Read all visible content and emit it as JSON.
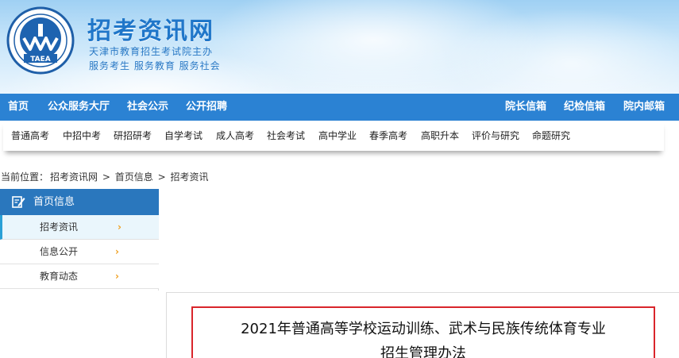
{
  "header": {
    "logo_text": "TAEA",
    "site_title": "招考资讯网",
    "org": "天津市教育招生考试院主办",
    "slogan": "服务考生 服务教育 服务社会"
  },
  "main_nav": {
    "left": [
      "首页",
      "公众服务大厅",
      "社会公示",
      "公开招聘"
    ],
    "right": [
      "院长信箱",
      "纪检信箱",
      "院内邮箱"
    ]
  },
  "sub_nav": [
    "普通高考",
    "中招中考",
    "研招研考",
    "自学考试",
    "成人高考",
    "社会考试",
    "高中学业",
    "春季高考",
    "高职升本",
    "评价与研究",
    "命题研究"
  ],
  "breadcrumb": {
    "prefix": "当前位置：",
    "items": [
      "招考资讯网",
      "首页信息",
      "招考资讯"
    ],
    "separator": ">"
  },
  "sidebar": {
    "heading": "首页信息",
    "items": [
      {
        "label": "招考资讯",
        "active": true
      },
      {
        "label": "信息公开",
        "active": false
      },
      {
        "label": "教育动态",
        "active": false
      }
    ],
    "chevron": "›"
  },
  "article": {
    "title_line1": "2021年普通高等学校运动训练、武术与民族传统体育专业",
    "title_line2": "招生管理办法"
  },
  "colors": {
    "nav_blue": "#2b82d3",
    "sidebar_blue": "#2a77bd",
    "title_red": "#d9252b",
    "chevron_orange": "#f0a020"
  }
}
